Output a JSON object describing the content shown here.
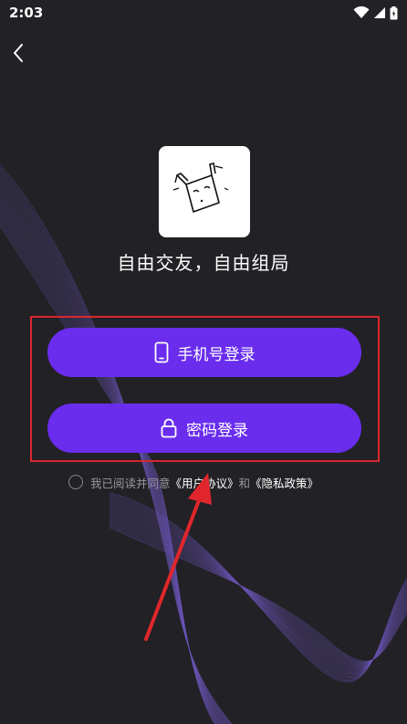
{
  "status_bar": {
    "time": "2:03"
  },
  "header": {
    "back_icon": "chevron-left-icon"
  },
  "app": {
    "tagline": "自由交友，自由组局"
  },
  "login": {
    "phone_label": "手机号登录",
    "phone_icon": "phone-icon",
    "password_label": "密码登录",
    "password_icon": "lock-icon"
  },
  "agreement": {
    "prefix": "我已阅读并同意",
    "user_agreement": "《用户协议》",
    "conjunction": "和",
    "privacy_policy": "《隐私政策》"
  },
  "colors": {
    "background": "#222125",
    "button": "#6a2dee",
    "highlight": "#d8282e",
    "wave": "#6b55b8"
  }
}
